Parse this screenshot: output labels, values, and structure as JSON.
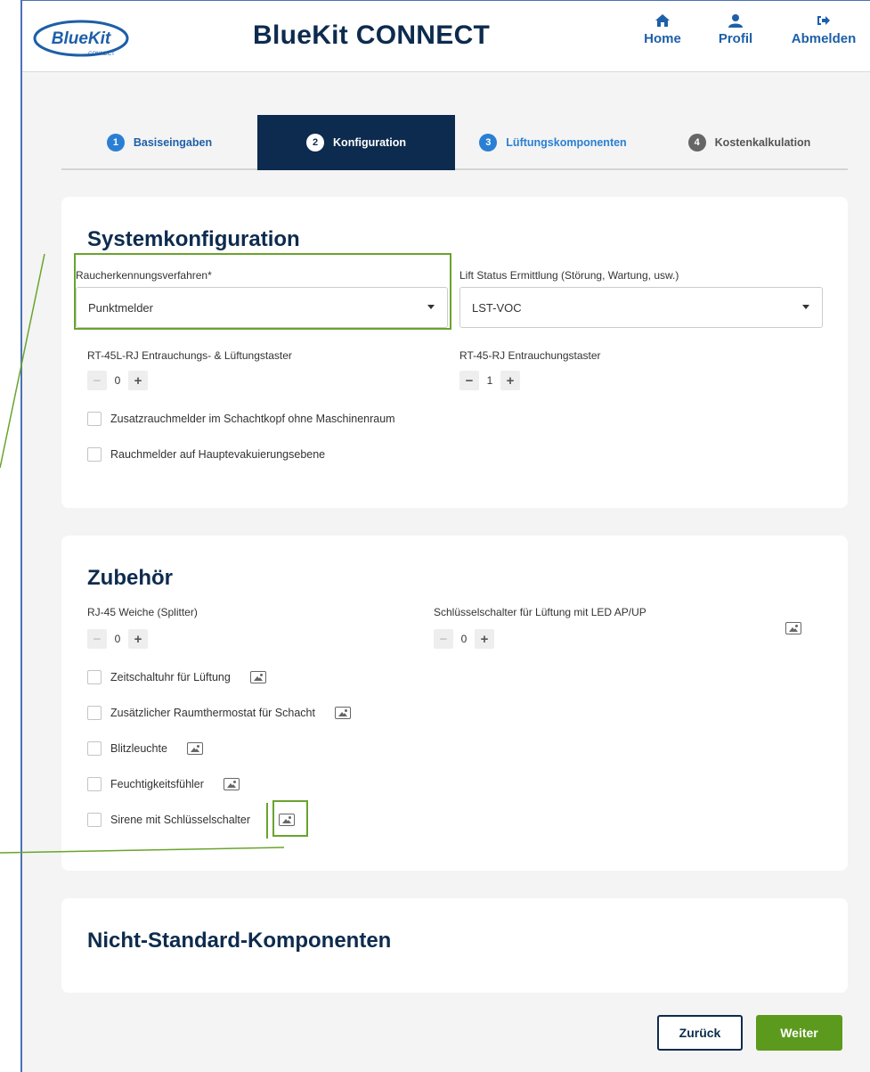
{
  "header": {
    "logo_text": "BlueKit",
    "logo_subtext": "CONNECT",
    "title": "BlueKit CONNECT",
    "nav": [
      {
        "label": "Home",
        "icon": "home-icon"
      },
      {
        "label": "Profil",
        "icon": "user-icon"
      },
      {
        "label": "Abmelden",
        "icon": "logout-icon"
      }
    ]
  },
  "steps": [
    {
      "num": "1",
      "label": "Basiseingaben"
    },
    {
      "num": "2",
      "label": "Konfiguration"
    },
    {
      "num": "3",
      "label": "Lüftungskomponenten"
    },
    {
      "num": "4",
      "label": "Kostenkalkulation"
    }
  ],
  "system": {
    "title": "Systemkonfiguration",
    "smoke_label": "Raucherkennungsverfahren*",
    "smoke_value": "Punktmelder",
    "lift_label": "Lift Status Ermittlung (Störung, Wartung, usw.)",
    "lift_value": "LST-VOC",
    "rt45l_label": "RT-45L-RJ Entrauchungs- & Lüftungstaster",
    "rt45l_value": "0",
    "rt45_label": "RT-45-RJ Entrauchungstaster",
    "rt45_value": "1",
    "check_1": "Zusatzrauchmelder im Schachtkopf ohne Maschinenraum",
    "check_2": "Rauchmelder auf Hauptevakuierungsebene"
  },
  "accessories": {
    "title": "Zubehör",
    "rj45_label": "RJ-45 Weiche (Splitter)",
    "rj45_value": "0",
    "key_label": "Schlüsselschalter für Lüftung mit LED AP/UP",
    "key_value": "0",
    "items": [
      "Zeitschaltuhr für Lüftung",
      "Zusätzlicher Raumthermostat für Schacht",
      "Blitzleuchte",
      "Feuchtigkeitsfühler",
      "Sirene mit Schlüsselschalter"
    ]
  },
  "nonstandard": {
    "title": "Nicht-Standard-Komponenten"
  },
  "footer": {
    "back": "Zurück",
    "next": "Weiter"
  },
  "colors": {
    "brand": "#0d2b4e",
    "accent": "#2a7fd4",
    "next_button": "#5c9a1e",
    "annotation": "#6aa32e"
  },
  "stepper_symbols": {
    "minus": "−",
    "plus": "+"
  }
}
